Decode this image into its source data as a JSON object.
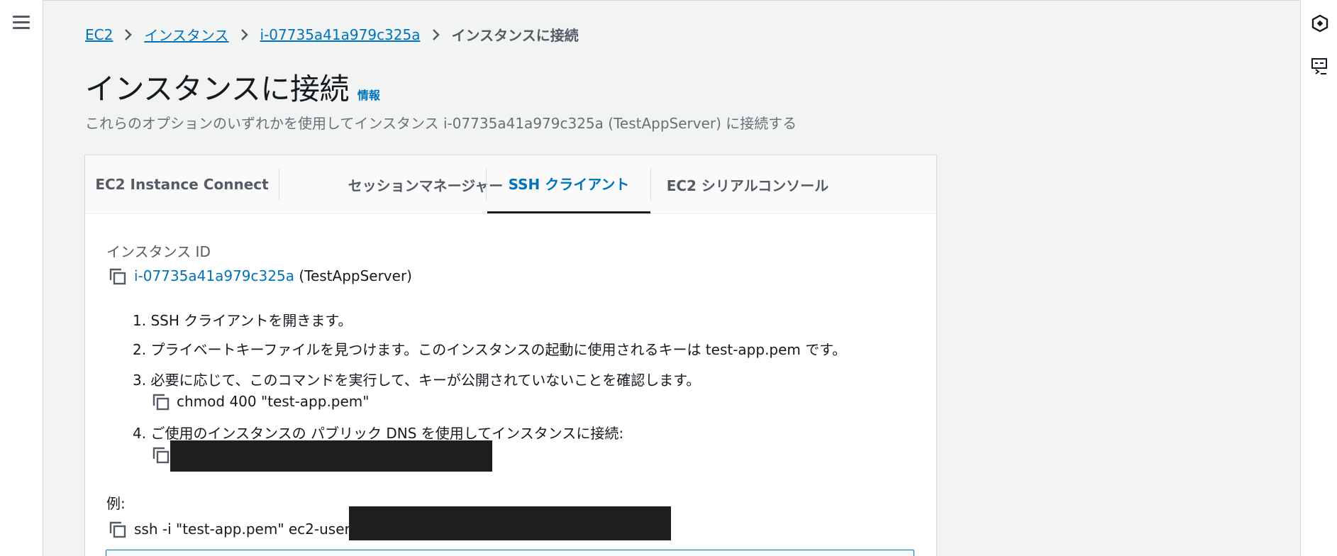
{
  "nav": {
    "menu_icon": "hamburger-menu-icon"
  },
  "right_rail": {
    "icons": [
      "cloudshell-hexagon-icon",
      "terminal-feedback-icon"
    ]
  },
  "breadcrumb": {
    "items": [
      "EC2",
      "インスタンス",
      "i-07735a41a979c325a"
    ],
    "current": "インスタンスに接続"
  },
  "header": {
    "title": "インスタンスに接続",
    "info_link": "情報",
    "description": "これらのオプションのいずれかを使用してインスタンス i-07735a41a979c325a (TestAppServer) に接続する"
  },
  "tabs": [
    {
      "label": "EC2 Instance Connect",
      "active": false
    },
    {
      "label": "セッションマネージャー",
      "active": false
    },
    {
      "label": "SSH クライアント",
      "active": true
    },
    {
      "label": "EC2 シリアルコンソール",
      "active": false
    }
  ],
  "instance": {
    "label": "インスタンス ID",
    "id": "i-07735a41a979c325a",
    "name": "(TestAppServer)"
  },
  "steps": [
    "1. SSH クライアントを開きます。",
    "2. プライベートキーファイルを見つけます。このインスタンスの起動に使用されるキーは test-app.pem です。",
    "3. 必要に応じて、このコマンドを実行して、キーが公開されていないことを確認します。",
    "4. ご使用のインスタンスの パブリック DNS を使用してインスタンスに接続:"
  ],
  "chmod_command": "chmod 400 \"test-app.pem\"",
  "example": {
    "label": "例:",
    "command_prefix": "ssh -i \"test-app.pem\" ec2-user@"
  },
  "colors": {
    "link": "#0073bb",
    "text": "#16191f",
    "muted": "#545b64",
    "background": "#f2f3f3"
  }
}
